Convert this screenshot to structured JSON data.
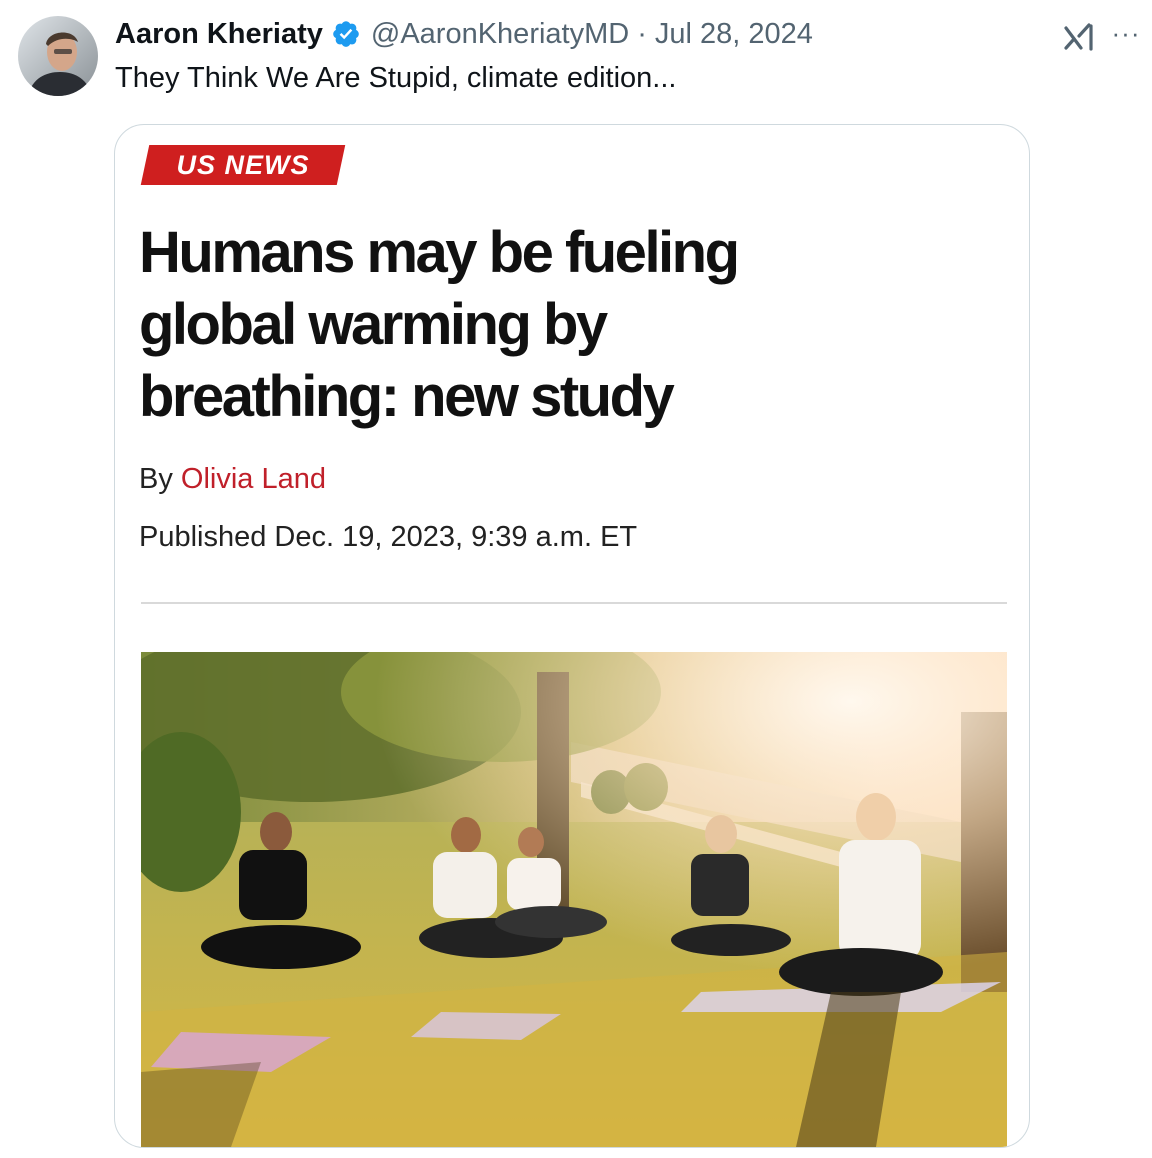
{
  "tweet": {
    "author_name": "Aaron Kheriaty",
    "handle": "@AaronKheriatyMD",
    "separator": "·",
    "date": "Jul 28, 2024",
    "text": "They Think We Are Stupid, climate edition...",
    "more_label": "···"
  },
  "article": {
    "section": "US NEWS",
    "headline_lines": [
      "Humans may be fueling",
      "global warming by",
      "breathing: new study"
    ],
    "by_prefix": "By",
    "author": "Olivia Land",
    "published": "Published Dec. 19, 2023, 9:39 a.m. ET"
  },
  "icons": {
    "verified": "verified-badge-icon",
    "grok": "grok-icon",
    "more": "more-options-icon"
  },
  "colors": {
    "verified_blue": "#1d9bf0",
    "section_red": "#cf1f1f",
    "author_link_red": "#c0202a",
    "muted_text": "#536471",
    "card_border": "#cfd9de"
  }
}
